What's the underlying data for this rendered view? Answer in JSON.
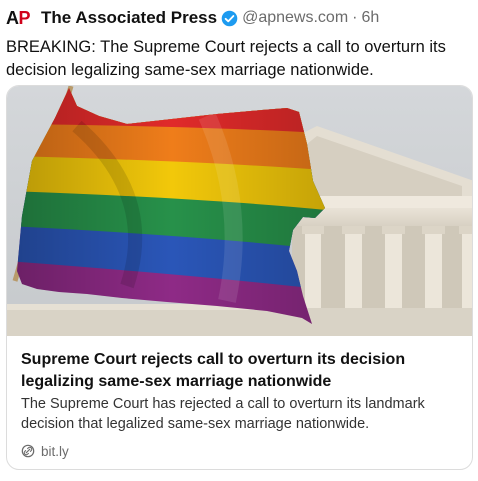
{
  "post": {
    "logo_a": "A",
    "logo_p": "P",
    "display_name": "The Associated Press",
    "verified_icon": "verified-badge-icon",
    "handle": "@apnews.com",
    "separator": "·",
    "time": "6h",
    "text": "BREAKING: The Supreme Court rejects a call to overturn its decision legalizing same-sex marriage nationwide."
  },
  "card": {
    "title": "Supreme Court rejects call to overturn its decision legalizing same-sex marriage nationwide",
    "description": "The Supreme Court has rejected a call to overturn its landmark decision that legalized same-sex marriage nationwide.",
    "source": "bit.ly",
    "source_icon": "link-icon"
  },
  "colors": {
    "brand_red": "#d0021b",
    "verified_blue": "#1d9bf0"
  }
}
